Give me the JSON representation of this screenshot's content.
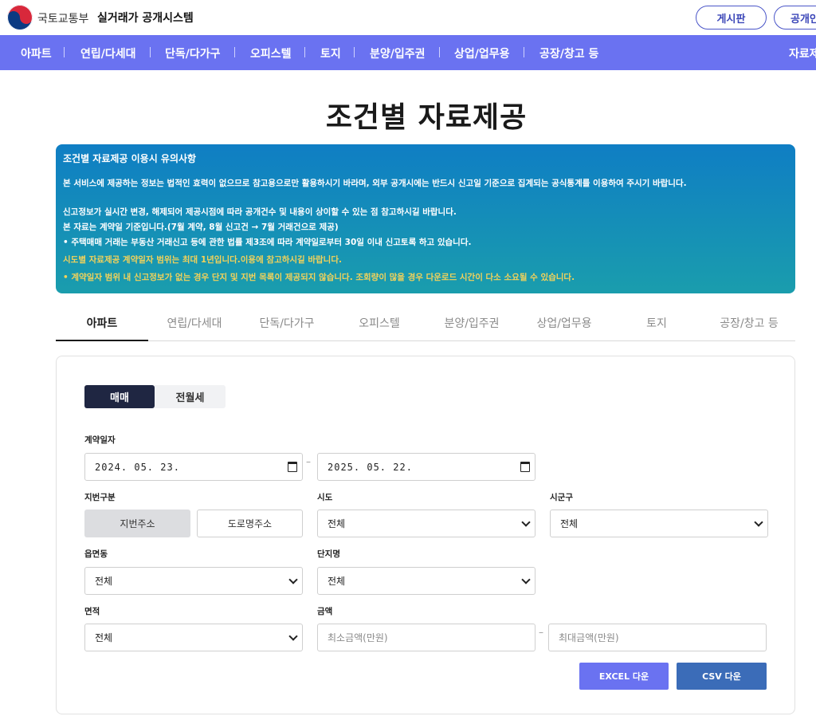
{
  "header": {
    "ministry": "국토교통부",
    "system_name": "실거래가 공개시스템",
    "board_button": "게시판",
    "public_button": "공개인"
  },
  "nav": {
    "items": [
      "아파트",
      "연립/다세대",
      "단독/다가구",
      "오피스텔",
      "토지",
      "분양/입주권",
      "상업/업무용",
      "공장/창고 등"
    ],
    "right_item": "자료제"
  },
  "page": {
    "title": "조건별 자료제공"
  },
  "notice": {
    "heading": "조건별 자료제공 이용시 유의사항",
    "line1": "본 서비스에 제공하는 정보는 법적인 효력이 없으므로 참고용으로만 활용하시기 바라며, 외부 공개시에는 반드시 신고일 기준으로 집계되는 공식통계를 이용하여 주시기 바랍니다.",
    "line2": "신고정보가 실시간 변경, 해제되어 제공시점에 따라 공개건수 및 내용이 상이할 수 있는 점 참고하시길 바랍니다.",
    "line3": "본 자료는 계약일 기준입니다.(7월 계약, 8월 신고건 → 7월 거래건으로 제공)",
    "line4": "• 주택매매 거래는 부동산 거래신고 등에 관한 법률 제3조에 따라 계약일로부터 30일 이내 신고토록 하고 있습니다.",
    "line5": "시도별 자료제공 계약일자 범위는 최대 1년입니다.이용에 참고하시길 바랍니다.",
    "line6": "• 계약일자 범위 내 신고정보가 없는 경우 단지 및 지번 목록이 제공되지 않습니다. 조회량이 많을 경우 다운로드 시간이 다소 소요될 수 있습니다.",
    "warn_color": "#f3d25a"
  },
  "tabs": [
    "아파트",
    "연립/다세대",
    "단독/다가구",
    "오피스텔",
    "분양/입주권",
    "상업/업무용",
    "토지",
    "공장/창고 등"
  ],
  "form": {
    "trade_types": [
      "매매",
      "전월세"
    ],
    "contract_date_label": "계약일자",
    "date_from": "2024. 05. 23.",
    "date_to": "2025. 05. 22.",
    "date_sep": "–",
    "lot_type_label": "지번구분",
    "lot_types": [
      "지번주소",
      "도로명주소"
    ],
    "sido_label": "시도",
    "sido_value": "전체",
    "sigungu_label": "시군구",
    "sigungu_value": "전체",
    "emd_label": "읍면동",
    "emd_value": "전체",
    "complex_label": "단지명",
    "complex_value": "전체",
    "area_label": "면적",
    "area_value": "전체",
    "price_label": "금액",
    "min_price_placeholder": "최소금액(만원)",
    "max_price_placeholder": "최대금액(만원)",
    "price_sep": "–",
    "excel_button": "EXCEL 다운",
    "csv_button": "CSV 다운"
  },
  "colors": {
    "nav_bg": "#6a72f1",
    "active_segment": "#1f2642",
    "excel_btn": "#6a72f1",
    "csv_btn": "#3b6cb8"
  },
  "icons": [
    "government-emblem-icon",
    "calendar-icon",
    "chevron-down-icon"
  ]
}
